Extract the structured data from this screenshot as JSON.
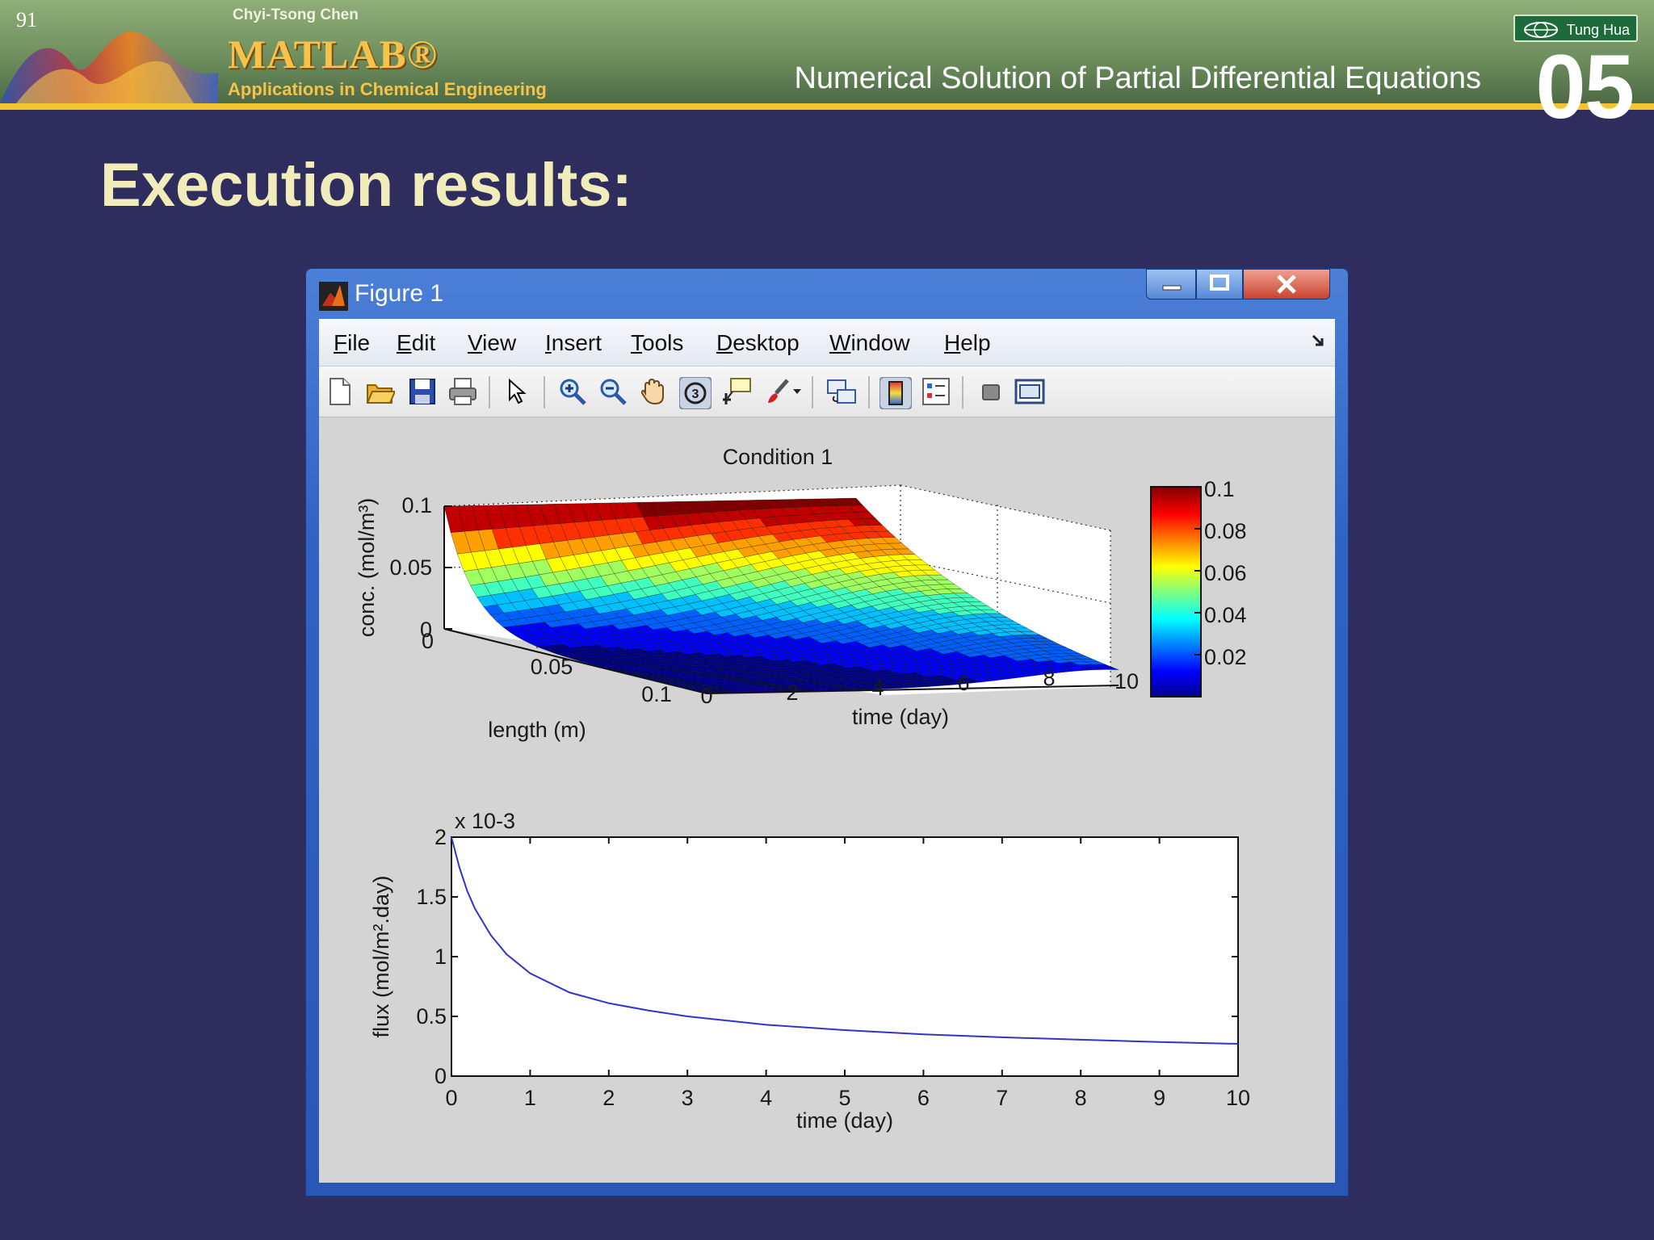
{
  "slide": {
    "number": "91",
    "author": "Chyi-Tsong Chen",
    "logo_text": "MATLAB®",
    "subtitle": "Applications in Chemical Engineering",
    "course_title": "Numerical Solution of Partial Differential Equations",
    "chapter": "05",
    "publisher": "Tung Hua",
    "heading": "Execution results:"
  },
  "window": {
    "title": "Figure 1",
    "menu": [
      "File",
      "Edit",
      "View",
      "Insert",
      "Tools",
      "Desktop",
      "Window",
      "Help"
    ],
    "toolbar_icons": [
      "new-file-icon",
      "open-folder-icon",
      "save-icon",
      "print-icon",
      "pointer-icon",
      "zoom-in-icon",
      "zoom-out-icon",
      "pan-hand-icon",
      "rotate-3d-icon",
      "data-cursor-icon",
      "brush-icon",
      "dropdown-arrow-icon",
      "link-plot-icon",
      "colorbar-icon",
      "legend-icon",
      "hide-plot-tools-icon",
      "show-plot-tools-icon"
    ]
  },
  "chart_data": [
    {
      "type": "surface",
      "title": "Condition 1",
      "xlabel": "length (m)",
      "ylabel": "time (day)",
      "zlabel": "conc. (mol/m³)",
      "xticks": [
        "0",
        "0.05",
        "0.1"
      ],
      "yticks": [
        "0",
        "2",
        "4",
        "6",
        "8",
        "10"
      ],
      "zticks": [
        "0",
        "0.05",
        "0.1"
      ],
      "xlim": [
        0,
        0.1
      ],
      "ylim": [
        0,
        10
      ],
      "zlim": [
        0,
        0.1
      ],
      "colormap": "jet",
      "colorbar_ticks": [
        "0.1",
        "0.08",
        "0.06",
        "0.04",
        "0.02"
      ],
      "colorbar_range": [
        0,
        0.1
      ],
      "grid": true
    },
    {
      "type": "line",
      "xlabel": "time (day)",
      "ylabel": "flux (mol/m².day)",
      "y_multiplier": "x 10-3",
      "xlim": [
        0,
        10
      ],
      "ylim": [
        0,
        2
      ],
      "xticks": [
        "0",
        "1",
        "2",
        "3",
        "4",
        "5",
        "6",
        "7",
        "8",
        "9",
        "10"
      ],
      "yticks": [
        "0",
        "0.5",
        "1",
        "1.5",
        "2"
      ],
      "series": [
        {
          "color": "#3333cc",
          "x": [
            0,
            0.1,
            0.2,
            0.3,
            0.5,
            0.7,
            1,
            1.5,
            2,
            2.5,
            3,
            4,
            5,
            6,
            7,
            8,
            9,
            10
          ],
          "y": [
            2.0,
            1.75,
            1.55,
            1.4,
            1.18,
            1.02,
            0.86,
            0.7,
            0.61,
            0.55,
            0.5,
            0.43,
            0.385,
            0.35,
            0.325,
            0.305,
            0.285,
            0.27
          ]
        }
      ]
    }
  ]
}
